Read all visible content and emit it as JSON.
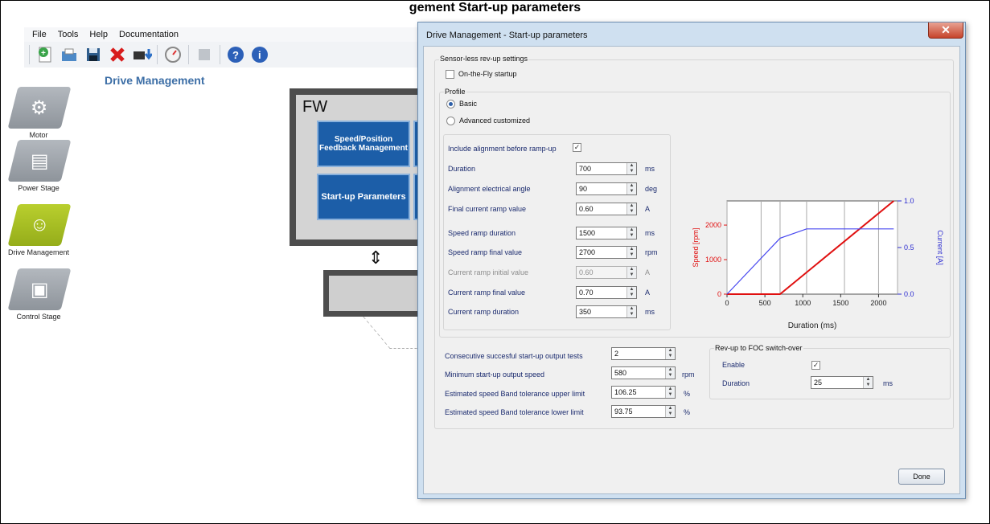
{
  "caption": "gement Start-up parameters",
  "menu": [
    "File",
    "Tools",
    "Help",
    "Documentation"
  ],
  "toolbar_icons": [
    "new-file-icon",
    "open-folder-icon",
    "save-icon",
    "delete-icon",
    "chip-download-icon",
    "gauge-icon",
    "plugin-icon",
    "help-icon",
    "info-icon"
  ],
  "sidebar": {
    "items": [
      {
        "label": "Motor",
        "icon": "motor-icon"
      },
      {
        "label": "Power Stage",
        "icon": "power-stage-icon"
      },
      {
        "label": "Drive Management",
        "icon": "drive-management-icon"
      },
      {
        "label": "Control Stage",
        "icon": "control-stage-icon"
      }
    ]
  },
  "main": {
    "title": "Drive Management",
    "fw_label": "FW",
    "fw_block_1": "Speed/Position Feedback Management",
    "fw_block_2": "Start-up Parameters"
  },
  "dialog": {
    "title": "Drive Management - Start-up parameters",
    "close": "✕",
    "sensorless": {
      "group_title": "Sensor-less rev-up settings",
      "on_the_fly": {
        "label": "On-the-Fly startup",
        "checked": false
      }
    },
    "profile": {
      "group_title": "Profile",
      "basic": {
        "label": "Basic",
        "selected": true
      },
      "advanced": {
        "label": "Advanced customized",
        "selected": false
      }
    },
    "alignment": {
      "label": "Include alignment before ramp-up",
      "checked": true
    },
    "params": [
      {
        "label": "Duration",
        "value": "700",
        "unit": "ms",
        "disabled": false
      },
      {
        "label": "Alignment electrical angle",
        "value": "90",
        "unit": "deg",
        "disabled": false
      },
      {
        "label": "Final current ramp value",
        "value": "0.60",
        "unit": "A",
        "disabled": false
      },
      {
        "label": "Speed ramp duration",
        "value": "1500",
        "unit": "ms",
        "disabled": false
      },
      {
        "label": "Speed ramp final value",
        "value": "2700",
        "unit": "rpm",
        "disabled": false
      },
      {
        "label": "Current ramp initial value",
        "value": "0.60",
        "unit": "A",
        "disabled": true
      },
      {
        "label": "Current ramp final value",
        "value": "0.70",
        "unit": "A",
        "disabled": false
      },
      {
        "label": "Current ramp duration",
        "value": "350",
        "unit": "ms",
        "disabled": false
      }
    ],
    "output": [
      {
        "label": "Consecutive succesful start-up output tests",
        "value": "2",
        "unit": ""
      },
      {
        "label": "Minimum start-up output speed",
        "value": "580",
        "unit": "rpm"
      },
      {
        "label": "Estimated speed Band tolerance upper limit",
        "value": "106.25",
        "unit": "%"
      },
      {
        "label": "Estimated speed Band tolerance lower limit",
        "value": "93.75",
        "unit": "%"
      }
    ],
    "foc": {
      "group_title": "Rev-up to FOC switch-over",
      "enable_label": "Enable",
      "enable_checked": true,
      "duration_label": "Duration",
      "duration_value": "25",
      "duration_unit": "ms"
    },
    "done": "Done"
  },
  "chart_data": {
    "type": "line",
    "xlabel": "Duration (ms)",
    "ylabel": "Speed [rpm]",
    "y2label": "Current [A]",
    "xlim": [
      0,
      2250
    ],
    "ylim": [
      0,
      2700
    ],
    "y2lim": [
      0,
      1.0
    ],
    "xticks": [
      "0",
      "500",
      "1000",
      "1500",
      "2000"
    ],
    "yticks": [
      "0",
      "1000",
      "2000"
    ],
    "y2ticks": [
      "0.0",
      "0.5",
      "1.0"
    ],
    "grid_x": [
      0,
      450,
      700,
      1050,
      1550,
      2000,
      2250
    ],
    "series": [
      {
        "axis": "left",
        "color": "#e01010",
        "x": [
          0,
          700,
          2200
        ],
        "y": [
          0,
          0,
          2700
        ]
      },
      {
        "axis": "right",
        "color": "#4848f0",
        "x": [
          0,
          700,
          1050,
          2200
        ],
        "y": [
          0,
          0.6,
          0.7,
          0.7
        ]
      }
    ]
  }
}
